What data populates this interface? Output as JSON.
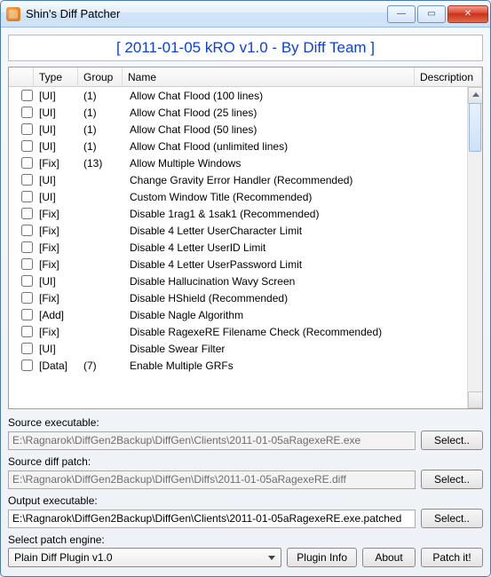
{
  "window": {
    "title": "Shin's Diff Patcher"
  },
  "header": {
    "text": "[ 2011-01-05 kRO  v1.0 - By Diff Team ]"
  },
  "columns": {
    "chk": "",
    "type": "Type",
    "group": "Group",
    "name": "Name",
    "desc": "Description"
  },
  "rows": [
    {
      "type": "[UI]",
      "group": "(1)",
      "name": "Allow Chat Flood (100 lines)"
    },
    {
      "type": "[UI]",
      "group": "(1)",
      "name": "Allow Chat Flood (25 lines)"
    },
    {
      "type": "[UI]",
      "group": "(1)",
      "name": "Allow Chat Flood (50 lines)"
    },
    {
      "type": "[UI]",
      "group": "(1)",
      "name": "Allow Chat Flood (unlimited lines)"
    },
    {
      "type": "[Fix]",
      "group": "(13)",
      "name": "Allow Multiple Windows"
    },
    {
      "type": "[UI]",
      "group": "",
      "name": "Change Gravity Error Handler (Recommended)"
    },
    {
      "type": "[UI]",
      "group": "",
      "name": "Custom Window Title (Recommended)"
    },
    {
      "type": "[Fix]",
      "group": "",
      "name": "Disable 1rag1 & 1sak1  (Recommended)"
    },
    {
      "type": "[Fix]",
      "group": "",
      "name": "Disable 4 Letter UserCharacter Limit"
    },
    {
      "type": "[Fix]",
      "group": "",
      "name": "Disable 4 Letter UserID Limit"
    },
    {
      "type": "[Fix]",
      "group": "",
      "name": "Disable 4 Letter UserPassword Limit"
    },
    {
      "type": "[UI]",
      "group": "",
      "name": "Disable Hallucination Wavy Screen"
    },
    {
      "type": "[Fix]",
      "group": "",
      "name": "Disable HShield (Recommended)"
    },
    {
      "type": "[Add]",
      "group": "",
      "name": "Disable Nagle Algorithm"
    },
    {
      "type": "[Fix]",
      "group": "",
      "name": "Disable RagexeRE Filename Check (Recommended)"
    },
    {
      "type": "[UI]",
      "group": "",
      "name": "Disable Swear Filter"
    },
    {
      "type": "[Data]",
      "group": "(7)",
      "name": "Enable Multiple GRFs"
    }
  ],
  "source_exe": {
    "label": "Source executable:",
    "value": "E:\\Ragnarok\\DiffGen2Backup\\DiffGen\\Clients\\2011-01-05aRagexeRE.exe",
    "button": "Select.."
  },
  "source_diff": {
    "label": "Source diff patch:",
    "value": "E:\\Ragnarok\\DiffGen2Backup\\DiffGen\\Diffs\\2011-01-05aRagexeRE.diff",
    "button": "Select.."
  },
  "output_exe": {
    "label": "Output executable:",
    "value": "E:\\Ragnarok\\DiffGen2Backup\\DiffGen\\Clients\\2011-01-05aRagexeRE.exe.patched",
    "button": "Select.."
  },
  "engine": {
    "label": "Select patch engine:",
    "value": "Plain Diff Plugin v1.0"
  },
  "buttons": {
    "plugin_info": "Plugin Info",
    "about": "About",
    "patch": "Patch it!"
  }
}
